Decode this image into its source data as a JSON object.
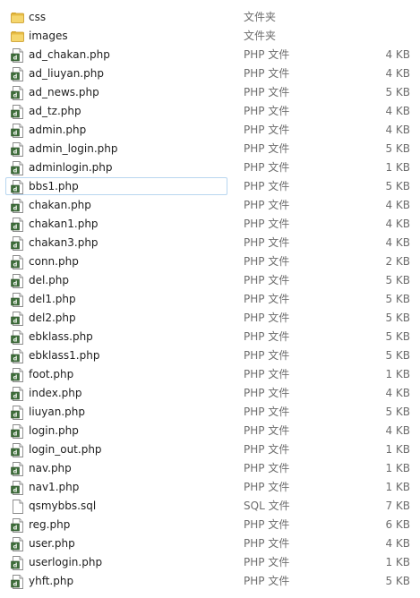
{
  "files": [
    {
      "name": "css",
      "type": "文件夹",
      "size": "",
      "icon": "folder-icon"
    },
    {
      "name": "images",
      "type": "文件夹",
      "size": "",
      "icon": "folder-icon"
    },
    {
      "name": "ad_chakan.php",
      "type": "PHP 文件",
      "size": "4 KB",
      "icon": "php-file-icon"
    },
    {
      "name": "ad_liuyan.php",
      "type": "PHP 文件",
      "size": "4 KB",
      "icon": "php-file-icon"
    },
    {
      "name": "ad_news.php",
      "type": "PHP 文件",
      "size": "5 KB",
      "icon": "php-file-icon"
    },
    {
      "name": "ad_tz.php",
      "type": "PHP 文件",
      "size": "4 KB",
      "icon": "php-file-icon"
    },
    {
      "name": "admin.php",
      "type": "PHP 文件",
      "size": "4 KB",
      "icon": "php-file-icon"
    },
    {
      "name": "admin_login.php",
      "type": "PHP 文件",
      "size": "5 KB",
      "icon": "php-file-icon"
    },
    {
      "name": "adminlogin.php",
      "type": "PHP 文件",
      "size": "1 KB",
      "icon": "php-file-icon"
    },
    {
      "name": "bbs1.php",
      "type": "PHP 文件",
      "size": "5 KB",
      "icon": "php-file-icon",
      "selected": true
    },
    {
      "name": "chakan.php",
      "type": "PHP 文件",
      "size": "4 KB",
      "icon": "php-file-icon"
    },
    {
      "name": "chakan1.php",
      "type": "PHP 文件",
      "size": "4 KB",
      "icon": "php-file-icon"
    },
    {
      "name": "chakan3.php",
      "type": "PHP 文件",
      "size": "4 KB",
      "icon": "php-file-icon"
    },
    {
      "name": "conn.php",
      "type": "PHP 文件",
      "size": "2 KB",
      "icon": "php-file-icon"
    },
    {
      "name": "del.php",
      "type": "PHP 文件",
      "size": "5 KB",
      "icon": "php-file-icon"
    },
    {
      "name": "del1.php",
      "type": "PHP 文件",
      "size": "5 KB",
      "icon": "php-file-icon"
    },
    {
      "name": "del2.php",
      "type": "PHP 文件",
      "size": "5 KB",
      "icon": "php-file-icon"
    },
    {
      "name": "ebklass.php",
      "type": "PHP 文件",
      "size": "5 KB",
      "icon": "php-file-icon"
    },
    {
      "name": "ebklass1.php",
      "type": "PHP 文件",
      "size": "5 KB",
      "icon": "php-file-icon"
    },
    {
      "name": "foot.php",
      "type": "PHP 文件",
      "size": "1 KB",
      "icon": "php-file-icon"
    },
    {
      "name": "index.php",
      "type": "PHP 文件",
      "size": "4 KB",
      "icon": "php-file-icon"
    },
    {
      "name": "liuyan.php",
      "type": "PHP 文件",
      "size": "5 KB",
      "icon": "php-file-icon"
    },
    {
      "name": "login.php",
      "type": "PHP 文件",
      "size": "4 KB",
      "icon": "php-file-icon"
    },
    {
      "name": "login_out.php",
      "type": "PHP 文件",
      "size": "1 KB",
      "icon": "php-file-icon"
    },
    {
      "name": "nav.php",
      "type": "PHP 文件",
      "size": "1 KB",
      "icon": "php-file-icon"
    },
    {
      "name": "nav1.php",
      "type": "PHP 文件",
      "size": "1 KB",
      "icon": "php-file-icon"
    },
    {
      "name": "qsmybbs.sql",
      "type": "SQL 文件",
      "size": "7 KB",
      "icon": "sql-file-icon"
    },
    {
      "name": "reg.php",
      "type": "PHP 文件",
      "size": "6 KB",
      "icon": "php-file-icon"
    },
    {
      "name": "user.php",
      "type": "PHP 文件",
      "size": "4 KB",
      "icon": "php-file-icon"
    },
    {
      "name": "userlogin.php",
      "type": "PHP 文件",
      "size": "1 KB",
      "icon": "php-file-icon"
    },
    {
      "name": "yhft.php",
      "type": "PHP 文件",
      "size": "5 KB",
      "icon": "php-file-icon"
    }
  ]
}
